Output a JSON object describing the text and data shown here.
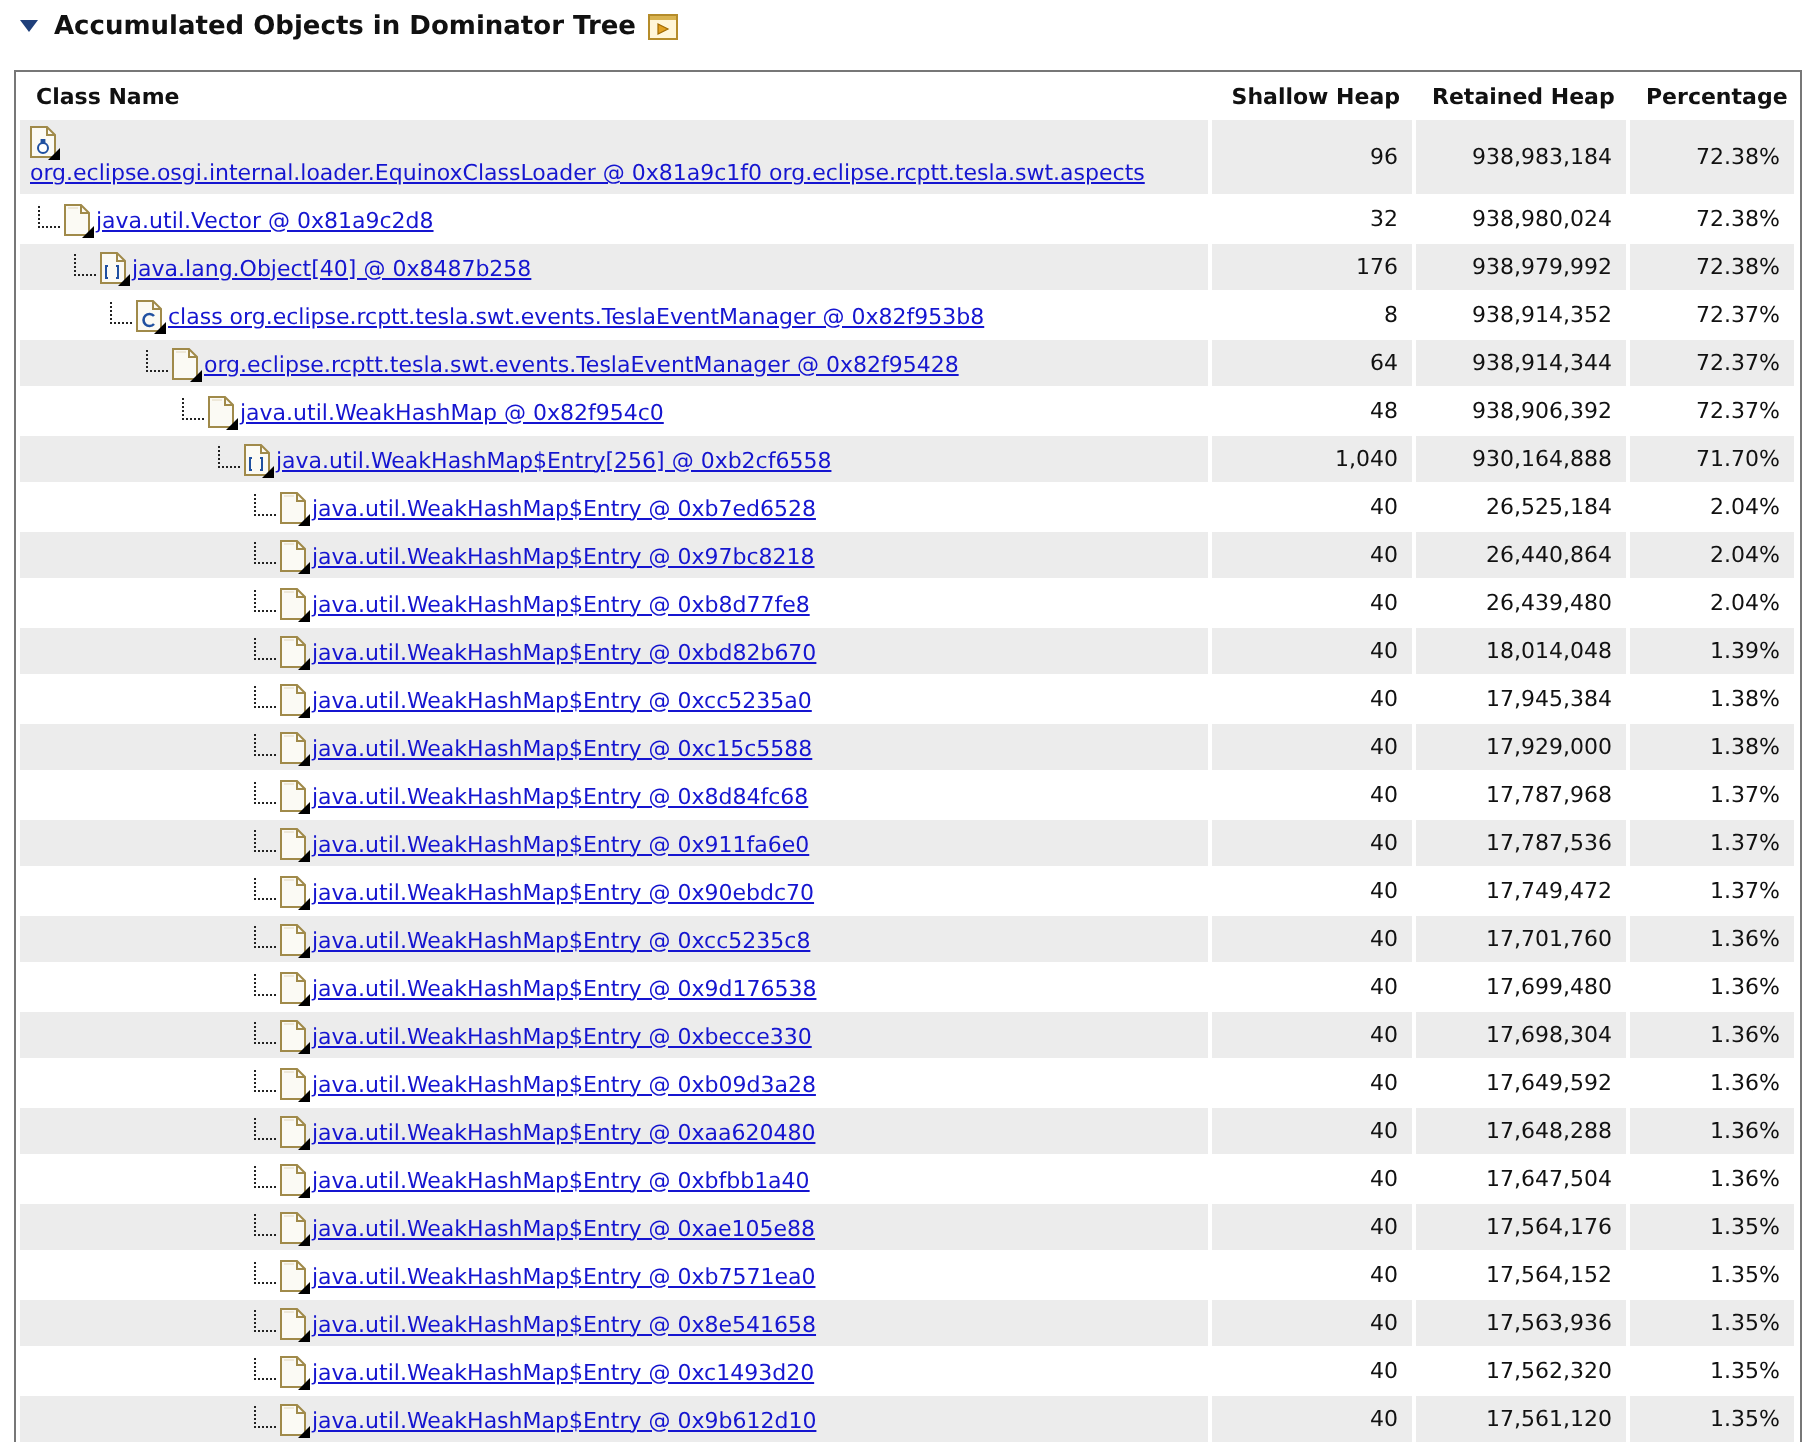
{
  "section": {
    "title": "Accumulated Objects in Dominator Tree",
    "expanded": true
  },
  "table": {
    "columns": [
      "Class Name",
      "Shallow Heap",
      "Retained Heap",
      "Percentage"
    ],
    "rows": [
      {
        "kind": "classloader",
        "name": "org.eclipse.osgi.internal.loader.EquinoxClassLoader @ 0x81a9c1f0 org.eclipse.rcptt.tesla.swt.aspects",
        "shallow": "96",
        "retained": "938,983,184",
        "percentage": "72.38%",
        "children": [
          {
            "kind": "object",
            "name": "java.util.Vector @ 0x81a9c2d8",
            "shallow": "32",
            "retained": "938,980,024",
            "percentage": "72.38%",
            "children": [
              {
                "kind": "array",
                "name": "java.lang.Object[40] @ 0x8487b258",
                "shallow": "176",
                "retained": "938,979,992",
                "percentage": "72.38%",
                "children": [
                  {
                    "kind": "class",
                    "name": "class org.eclipse.rcptt.tesla.swt.events.TeslaEventManager @ 0x82f953b8",
                    "shallow": "8",
                    "retained": "938,914,352",
                    "percentage": "72.37%",
                    "children": [
                      {
                        "kind": "object",
                        "name": "org.eclipse.rcptt.tesla.swt.events.TeslaEventManager @ 0x82f95428",
                        "shallow": "64",
                        "retained": "938,914,344",
                        "percentage": "72.37%",
                        "children": [
                          {
                            "kind": "object",
                            "name": "java.util.WeakHashMap @ 0x82f954c0",
                            "shallow": "48",
                            "retained": "938,906,392",
                            "percentage": "72.37%",
                            "children": [
                              {
                                "kind": "array",
                                "name": "java.util.WeakHashMap$Entry[256] @ 0xb2cf6558",
                                "shallow": "1,040",
                                "retained": "930,164,888",
                                "percentage": "71.70%",
                                "children": [
                                  {
                                    "kind": "object",
                                    "name": "java.util.WeakHashMap$Entry @ 0xb7ed6528",
                                    "shallow": "40",
                                    "retained": "26,525,184",
                                    "percentage": "2.04%"
                                  },
                                  {
                                    "kind": "object",
                                    "name": "java.util.WeakHashMap$Entry @ 0x97bc8218",
                                    "shallow": "40",
                                    "retained": "26,440,864",
                                    "percentage": "2.04%"
                                  },
                                  {
                                    "kind": "object",
                                    "name": "java.util.WeakHashMap$Entry @ 0xb8d77fe8",
                                    "shallow": "40",
                                    "retained": "26,439,480",
                                    "percentage": "2.04%"
                                  },
                                  {
                                    "kind": "object",
                                    "name": "java.util.WeakHashMap$Entry @ 0xbd82b670",
                                    "shallow": "40",
                                    "retained": "18,014,048",
                                    "percentage": "1.39%"
                                  },
                                  {
                                    "kind": "object",
                                    "name": "java.util.WeakHashMap$Entry @ 0xcc5235a0",
                                    "shallow": "40",
                                    "retained": "17,945,384",
                                    "percentage": "1.38%"
                                  },
                                  {
                                    "kind": "object",
                                    "name": "java.util.WeakHashMap$Entry @ 0xc15c5588",
                                    "shallow": "40",
                                    "retained": "17,929,000",
                                    "percentage": "1.38%"
                                  },
                                  {
                                    "kind": "object",
                                    "name": "java.util.WeakHashMap$Entry @ 0x8d84fc68",
                                    "shallow": "40",
                                    "retained": "17,787,968",
                                    "percentage": "1.37%"
                                  },
                                  {
                                    "kind": "object",
                                    "name": "java.util.WeakHashMap$Entry @ 0x911fa6e0",
                                    "shallow": "40",
                                    "retained": "17,787,536",
                                    "percentage": "1.37%"
                                  },
                                  {
                                    "kind": "object",
                                    "name": "java.util.WeakHashMap$Entry @ 0x90ebdc70",
                                    "shallow": "40",
                                    "retained": "17,749,472",
                                    "percentage": "1.37%"
                                  },
                                  {
                                    "kind": "object",
                                    "name": "java.util.WeakHashMap$Entry @ 0xcc5235c8",
                                    "shallow": "40",
                                    "retained": "17,701,760",
                                    "percentage": "1.36%"
                                  },
                                  {
                                    "kind": "object",
                                    "name": "java.util.WeakHashMap$Entry @ 0x9d176538",
                                    "shallow": "40",
                                    "retained": "17,699,480",
                                    "percentage": "1.36%"
                                  },
                                  {
                                    "kind": "object",
                                    "name": "java.util.WeakHashMap$Entry @ 0xbecce330",
                                    "shallow": "40",
                                    "retained": "17,698,304",
                                    "percentage": "1.36%"
                                  },
                                  {
                                    "kind": "object",
                                    "name": "java.util.WeakHashMap$Entry @ 0xb09d3a28",
                                    "shallow": "40",
                                    "retained": "17,649,592",
                                    "percentage": "1.36%"
                                  },
                                  {
                                    "kind": "object",
                                    "name": "java.util.WeakHashMap$Entry @ 0xaa620480",
                                    "shallow": "40",
                                    "retained": "17,648,288",
                                    "percentage": "1.36%"
                                  },
                                  {
                                    "kind": "object",
                                    "name": "java.util.WeakHashMap$Entry @ 0xbfbb1a40",
                                    "shallow": "40",
                                    "retained": "17,647,504",
                                    "percentage": "1.36%"
                                  },
                                  {
                                    "kind": "object",
                                    "name": "java.util.WeakHashMap$Entry @ 0xae105e88",
                                    "shallow": "40",
                                    "retained": "17,564,176",
                                    "percentage": "1.35%"
                                  },
                                  {
                                    "kind": "object",
                                    "name": "java.util.WeakHashMap$Entry @ 0xb7571ea0",
                                    "shallow": "40",
                                    "retained": "17,564,152",
                                    "percentage": "1.35%"
                                  },
                                  {
                                    "kind": "object",
                                    "name": "java.util.WeakHashMap$Entry @ 0x8e541658",
                                    "shallow": "40",
                                    "retained": "17,563,936",
                                    "percentage": "1.35%"
                                  },
                                  {
                                    "kind": "object",
                                    "name": "java.util.WeakHashMap$Entry @ 0xc1493d20",
                                    "shallow": "40",
                                    "retained": "17,562,320",
                                    "percentage": "1.35%"
                                  },
                                  {
                                    "kind": "object",
                                    "name": "java.util.WeakHashMap$Entry @ 0x9b612d10",
                                    "shallow": "40",
                                    "retained": "17,561,120",
                                    "percentage": "1.35%"
                                  }
                                ]
                              }
                            ]
                          }
                        ]
                      }
                    ]
                  }
                ]
              }
            ]
          }
        ]
      }
    ]
  }
}
